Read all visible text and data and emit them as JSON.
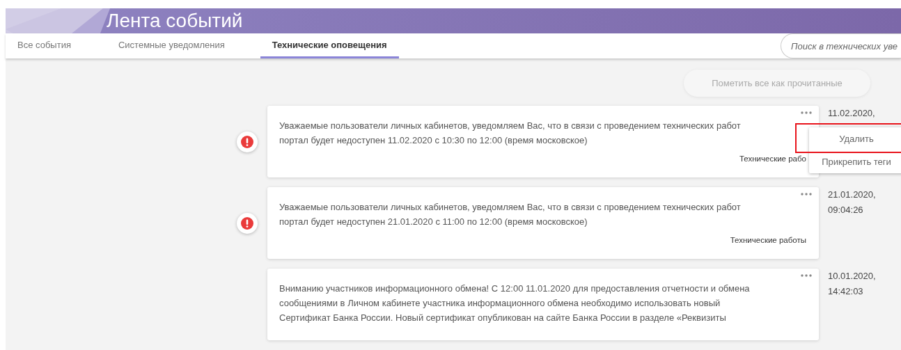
{
  "header": {
    "title": "Лента событий"
  },
  "tabs": [
    {
      "label": "Все события",
      "selected": false
    },
    {
      "label": "Системные уведомления",
      "selected": false
    },
    {
      "label": "Технические оповещения",
      "selected": true
    }
  ],
  "search": {
    "placeholder": "Поиск в технических уве"
  },
  "mark_all_button": {
    "label": "Пометить все как прочитанные",
    "disabled": true
  },
  "events": [
    {
      "important": true,
      "text": "Уважаемые пользователи личных кабинетов, уведомляем Вас, что в связи с проведением технических работ портал будет недоступен 11.02.2020 с 10:30 по 12:00 (время московское)",
      "tag": "Технические рабо",
      "date": "11.02.2020,",
      "menu_open": true,
      "menu": [
        {
          "label": "Удалить",
          "highlighted": true
        },
        {
          "label": "Прикрепить теги",
          "highlighted": false
        }
      ]
    },
    {
      "important": true,
      "text": "Уважаемые пользователи личных кабинетов, уведомляем Вас, что в связи с проведением технических работ портал будет недоступен 21.01.2020 с 11:00 по 12:00 (время московское)",
      "tag": "Технические работы",
      "date": "21.01.2020,",
      "time": "09:04:26",
      "menu_open": false
    },
    {
      "important": false,
      "text": "Вниманию участников информационного обмена! С 12:00 11.01.2020 для предоставления отчетности и обмена сообщениями в Личном кабинете участника информационного обмена необходимо использовать новый Сертификат Банка России. Новый сертификат опубликован на сайте Банка России в разделе «Реквизиты",
      "date": "10.01.2020,",
      "time": "14:42:03",
      "menu_open": false
    }
  ]
}
